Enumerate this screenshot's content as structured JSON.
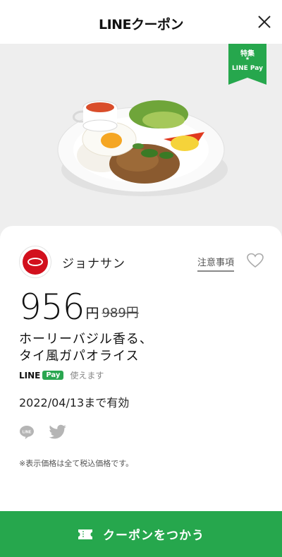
{
  "header": {
    "title": "LINEクーポン",
    "close_icon": "close-icon"
  },
  "badge": {
    "top": "特集",
    "bottom": "LINE Pay",
    "color": "#26a74d"
  },
  "coupon": {
    "brand_name": "ジョナサン",
    "notes_label": "注意事項",
    "price": "956",
    "price_unit": "円",
    "original_price": "989円",
    "title_line1": "ホーリーバジル香る、",
    "title_line2": "タイ風ガパオライス",
    "pay_brand_line": "LINE",
    "pay_brand_box": "Pay",
    "pay_note": "使えます",
    "expiry": "2022/04/13まで有効",
    "tax_note": "※表示価格は全て税込価格です。"
  },
  "share": {
    "line_icon": "line-icon",
    "twitter_icon": "twitter-icon"
  },
  "action": {
    "label": "クーポンをつかう",
    "color": "#26a74d"
  }
}
